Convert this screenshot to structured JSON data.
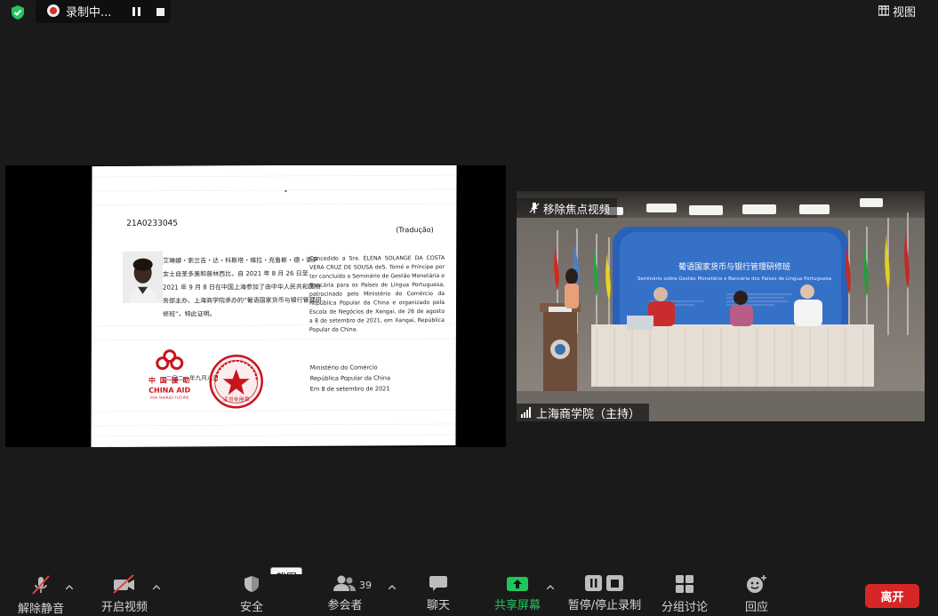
{
  "top_bar": {
    "recording_status": "录制中...",
    "view_label": "视图"
  },
  "share_tile": {
    "certificate": {
      "serial": "21A0233045",
      "translation_tag": "(Tradução)",
      "zh_body": "艾琳娜・索兰吉・达・科斯塔・维拉・克鲁斯・德・索萨女士自圣多美和普林西比，自 2021 年 8 月 26 日至 2021 年 9 月 8 日在中国上海参加了由中华人民共和国商务部主办、上海商学院承办的“葡语国家货币与银行管理研修班”，特此证明。",
      "pt_body": "Concedido a Sra. ÉLENA SOLANGE DA COSTA VERA CRUZ DE SOUSA deS. Tomé e Príncipe por ter concluído o Seminário de Gestão Monetária e Bancária para os Países de Língua Portuguesa, patrocinado pelo Ministério do Comércio da República Popular da China e organizado pela Escola de Negócios de Xangai, de 26 de agosto a 8 de setembro de 2021, em Xangai, República Popular da China.",
      "ministry_line_1": "Ministério do Comércio",
      "ministry_line_2": "República Popular da China",
      "ministry_date": "Em 8 de setembro de 2021",
      "aid_logo_zh": "中 国 援 助",
      "aid_logo_en": "CHINA AID",
      "aid_logo_sub": "FOR SHARED FUTURE",
      "seal_date": "二〇二一年九月八日",
      "seal_text": "证书专用章"
    }
  },
  "speaker_tile": {
    "focus_label": "移除焦点视频",
    "participant_name": "上海商学院（主持）",
    "banner_title": "葡语国家货币与银行管理研修班",
    "banner_subtitle": "Seminário sobre Gestão Monetária e Bancária dos Países de Língua Portuguesa"
  },
  "tooltip": {
    "text": "截图"
  },
  "toolbar": {
    "unmute_label": "解除静音",
    "start_video_label": "开启视频",
    "security_label": "安全",
    "participants_label": "参会者",
    "participants_count": "39",
    "chat_label": "聊天",
    "share_screen_label": "共享屏幕",
    "recording_label": "暂停/停止录制",
    "breakout_label": "分组讨论",
    "reactions_label": "回应",
    "leave_label": "离开"
  },
  "colors": {
    "background": "#1a1a1a",
    "share_green": "#21c55d",
    "leave_red": "#d72626",
    "recording_red": "#d92d2d",
    "banner_blue": "#2b60b8"
  }
}
